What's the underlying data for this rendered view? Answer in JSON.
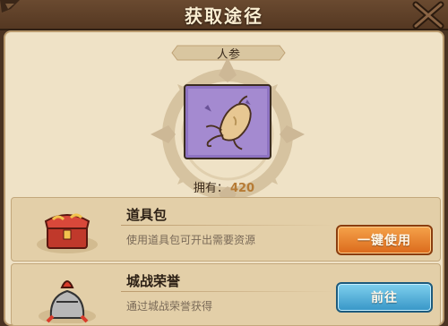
{
  "header": {
    "title": "获取途径"
  },
  "item": {
    "name": "人参",
    "owned_label": "拥有：",
    "owned_count": "420"
  },
  "sources": [
    {
      "title": "道具包",
      "description": "使用道具包可开出需要资源",
      "button": "一键使用",
      "icon": "red-chest-icon"
    },
    {
      "title": "城战荣誉",
      "description": "通过城战荣誉获得",
      "button": "前往",
      "icon": "helmet-icon"
    }
  ],
  "colors": {
    "panel": "#efe2c6",
    "title_bar": "#5f432b",
    "item_frame": "#a48ad0",
    "owned_count": "#b67b35",
    "button_orange": "#e27a22",
    "button_blue": "#4aa7d3"
  }
}
